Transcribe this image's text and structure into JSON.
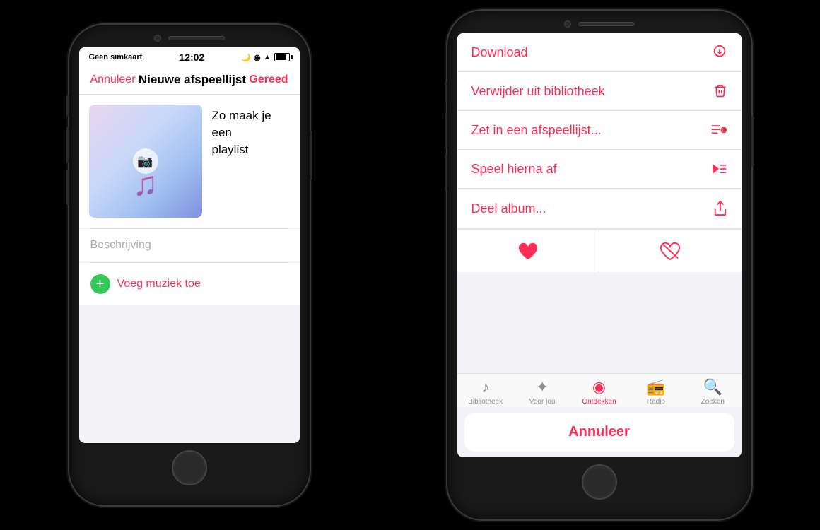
{
  "left_phone": {
    "status_bar": {
      "carrier": "Geen simkaart",
      "wifi": "📶",
      "time": "12:02",
      "moon": "🌙",
      "location": "◉",
      "battery_label": ""
    },
    "nav": {
      "cancel": "Annuleer",
      "title": "Nieuwe afspeellijst",
      "done": "Gereed"
    },
    "playlist": {
      "title_line1": "Zo maak je een",
      "title_line2": "playlist",
      "description_placeholder": "Beschrijving"
    },
    "add_music": "Voeg muziek toe"
  },
  "right_phone": {
    "actions": [
      {
        "label": "Download",
        "icon": "⬇"
      },
      {
        "label": "Verwijder uit bibliotheek",
        "icon": "🗑"
      },
      {
        "label": "Zet in een afspeellijst...",
        "icon": "➕≡"
      },
      {
        "label": "Speel hierna af",
        "icon": "▶≡"
      },
      {
        "label": "Deel album...",
        "icon": "⬆"
      }
    ],
    "love_label": "❤️",
    "unlove_label": "🤍",
    "tab_bar": [
      {
        "label": "Bibliotheek",
        "icon": "♪",
        "active": false
      },
      {
        "label": "Voor jou",
        "icon": "✦",
        "active": false
      },
      {
        "label": "Ontdekken",
        "icon": "◉",
        "active": true
      },
      {
        "label": "Radio",
        "icon": "📻",
        "active": false
      },
      {
        "label": "Zoeken",
        "icon": "🔍",
        "active": false
      }
    ],
    "cancel_label": "Annuleer"
  }
}
